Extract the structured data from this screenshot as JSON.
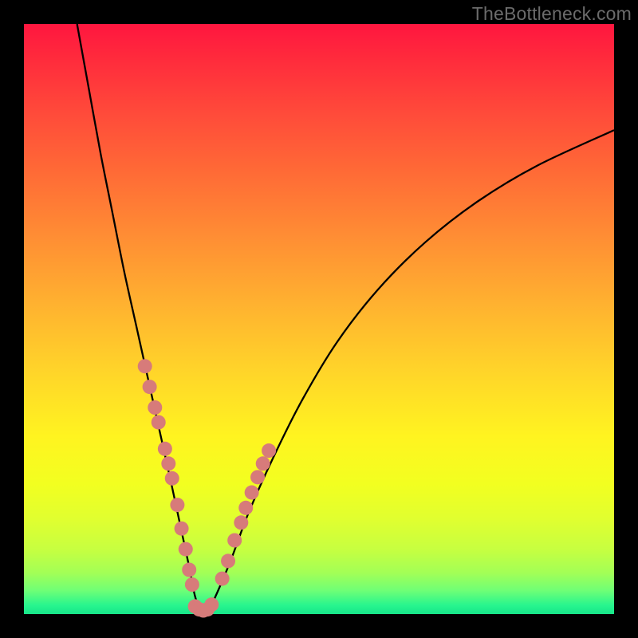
{
  "watermark": "TheBottleneck.com",
  "colors": {
    "frame": "#000000",
    "curve": "#000000",
    "marker_fill": "#d77b7a",
    "marker_stroke": "#d77b7a"
  },
  "chart_data": {
    "type": "line",
    "title": "",
    "xlabel": "",
    "ylabel": "",
    "xlim": [
      0,
      100
    ],
    "ylim": [
      0,
      100
    ],
    "series": [
      {
        "name": "bottleneck-curve",
        "x": [
          9,
          11,
          13,
          15,
          17,
          19,
          21,
          23,
          25,
          26.5,
          28,
          29,
          30,
          31,
          32,
          35,
          38,
          42,
          47,
          53,
          60,
          68,
          77,
          87,
          100
        ],
        "y": [
          100,
          89,
          78,
          68,
          58,
          49,
          40,
          31,
          22,
          15,
          8,
          3,
          0.5,
          0.5,
          2,
          9,
          17,
          26,
          36,
          46,
          55,
          63,
          70,
          76,
          82
        ]
      }
    ],
    "markers": [
      {
        "name": "left-branch-dots",
        "x": [
          20.5,
          21.3,
          22.2,
          22.8,
          23.9,
          24.5,
          25.1,
          26.0,
          26.7,
          27.4,
          28.0,
          28.5
        ],
        "y": [
          42,
          38.5,
          35,
          32.5,
          28,
          25.5,
          23,
          18.5,
          14.5,
          11,
          7.5,
          5
        ]
      },
      {
        "name": "valley-dots",
        "x": [
          29.0,
          29.7,
          30.4,
          31.1,
          31.8
        ],
        "y": [
          1.3,
          0.8,
          0.6,
          0.8,
          1.6
        ]
      },
      {
        "name": "right-branch-dots",
        "x": [
          33.6,
          34.6,
          35.7,
          36.8,
          37.6,
          38.6,
          39.6,
          40.5,
          41.5
        ],
        "y": [
          6,
          9,
          12.5,
          15.5,
          18,
          20.6,
          23.2,
          25.5,
          27.7
        ]
      }
    ]
  }
}
